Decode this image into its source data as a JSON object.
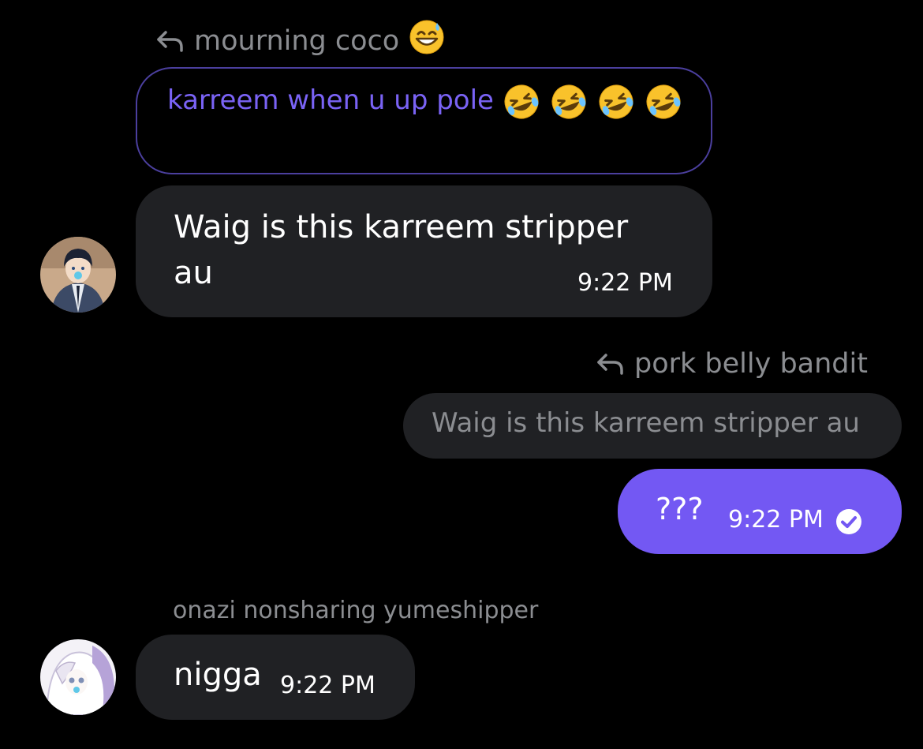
{
  "messages": [
    {
      "reply_to_name": "mourning coco",
      "reply_to_text": "karreem when u up pole",
      "text": "Waig is this karreem stripper au",
      "time": "9:22 PM"
    },
    {
      "reply_to_name": "pork belly bandit",
      "reply_to_text": "Waig is this karreem stripper au",
      "text": "???",
      "time": "9:22 PM",
      "status": "read"
    },
    {
      "sender": "onazi nonsharing yumeshipper",
      "text": "nigga",
      "time": "9:22 PM"
    }
  ],
  "icons": {
    "reply": "reply-arrow-icon",
    "sweat_emoji": "grinning-sweat-emoji",
    "laugh_emoji": "rolling-on-floor-laughing-emoji",
    "read": "check-circle-icon"
  },
  "colors": {
    "background": "#000000",
    "incoming_bubble": "#202124",
    "outgoing_bubble": "#7358f3",
    "quote_text": "#7a63f5",
    "quote_border": "#4b3f9e",
    "muted_text": "#8b8d91"
  }
}
